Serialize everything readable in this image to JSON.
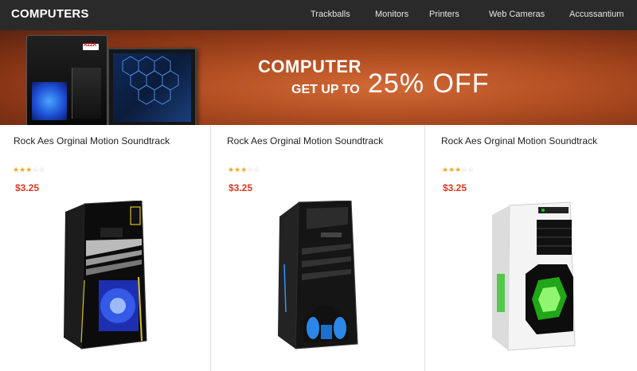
{
  "brand": "COMPUTERS",
  "nav": [
    {
      "label": "Trackballs"
    },
    {
      "label": "Monitors"
    },
    {
      "label": "Printers"
    },
    {
      "label": "Web Cameras"
    },
    {
      "label": "Accussantium"
    }
  ],
  "banner": {
    "line1": "COMPUTER",
    "line2": "GET UP TO",
    "discount": "25% OFF",
    "logo_text": "AZZA"
  },
  "products": [
    {
      "title": "Rock Aes Orginal Motion Soundtrack",
      "rating": 3,
      "rating_max": 5,
      "price": "$3.25",
      "case_color": "black",
      "accent_color": "#2a54e0"
    },
    {
      "title": "Rock Aes Orginal Motion Soundtrack",
      "rating": 3,
      "rating_max": 5,
      "price": "$3.25",
      "case_color": "black",
      "accent_color": "#2a8de0"
    },
    {
      "title": "Rock Aes Orginal Motion Soundtrack",
      "rating": 3,
      "rating_max": 5,
      "price": "$3.25",
      "case_color": "white",
      "accent_color": "#25c21a"
    }
  ],
  "colors": {
    "topbar": "#2a2a2a",
    "price": "#e0371f",
    "star_on": "#f0a720",
    "star_off": "#cccccc"
  },
  "icons": [
    "star-icon"
  ]
}
